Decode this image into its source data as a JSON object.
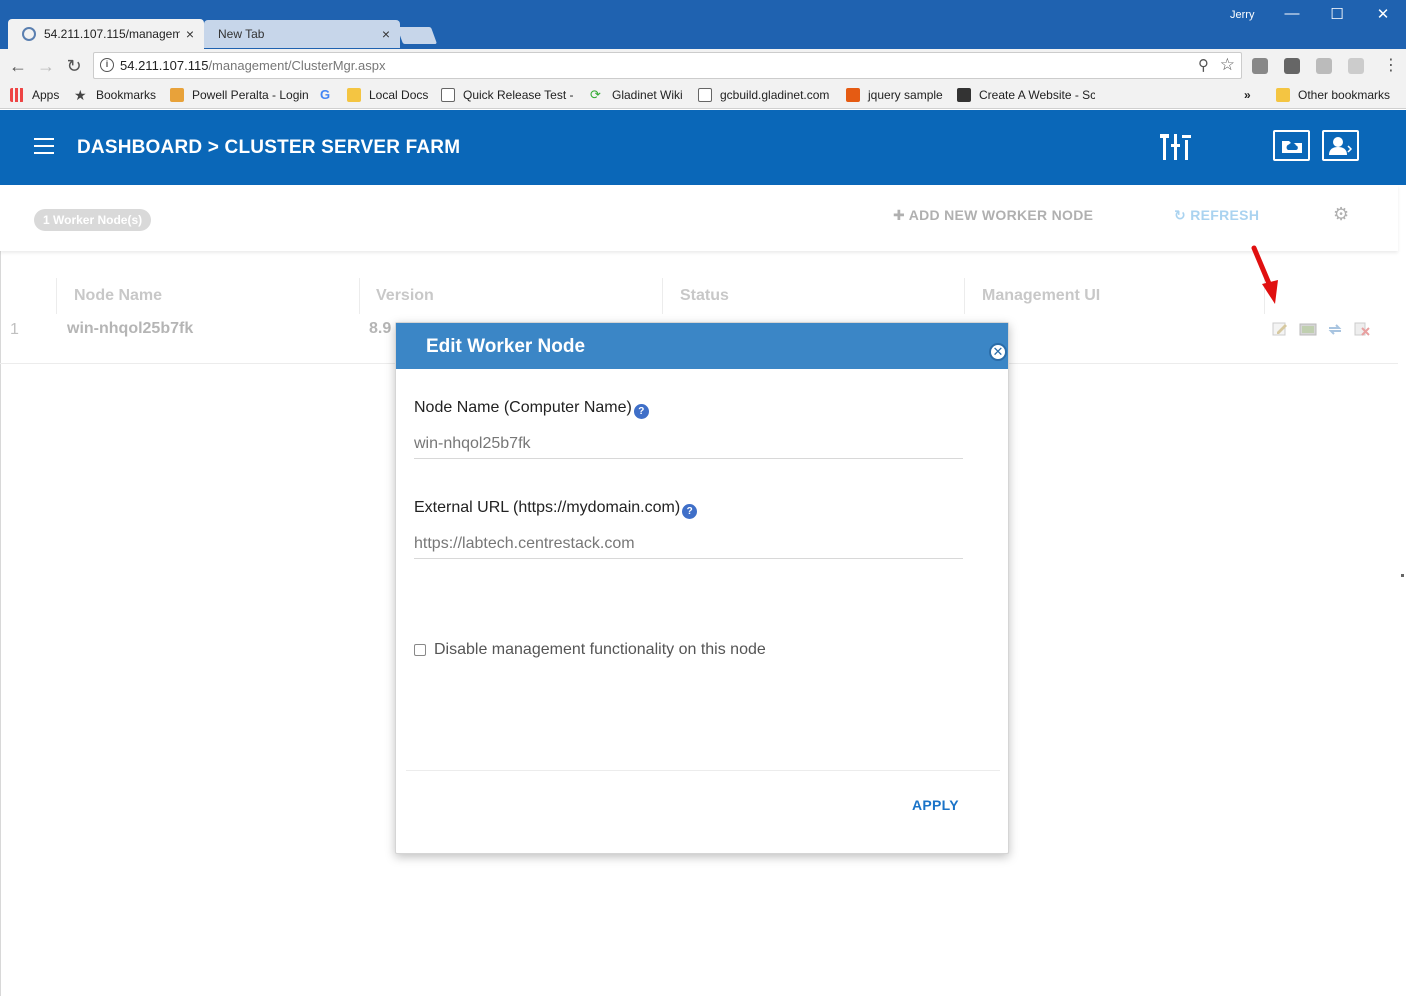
{
  "browser": {
    "tabs": [
      {
        "title": "54.211.107.115/managem",
        "close": "×"
      },
      {
        "title": "New Tab",
        "close": "×"
      }
    ],
    "user": "Jerry",
    "window_controls": {
      "minimize": "—",
      "maximize": "☐",
      "close": "✕"
    },
    "url_host": "54.211.107.115",
    "url_path": "/management/ClusterMgr.aspx",
    "bookmarks": [
      "Apps",
      "Bookmarks",
      "Powell Peralta - Login",
      "",
      "Local Docs",
      "Quick Release Test - (",
      "Gladinet Wiki",
      "gcbuild.gladinet.com",
      "jquery sample",
      "Create A Website - Sc"
    ],
    "bookmarks_overflow": "»",
    "other_bookmarks": "Other bookmarks"
  },
  "header": {
    "breadcrumb": "DASHBOARD >  CLUSTER SERVER FARM"
  },
  "toolbar": {
    "node_count_badge": "1 Worker Node(s)",
    "add_node_label": "ADD NEW WORKER NODE",
    "refresh_label": "REFRESH"
  },
  "table": {
    "columns": [
      "Node Name",
      "Version",
      "Status",
      "Management UI"
    ],
    "rows": [
      {
        "num": "1",
        "node_name": "win-nhqol25b7fk",
        "version": "8.9"
      }
    ]
  },
  "modal": {
    "title": "Edit Worker Node",
    "node_name_label": "Node Name (Computer Name)",
    "node_name_value": "win-nhqol25b7fk",
    "external_url_label": "External URL (https://mydomain.com)",
    "external_url_value": "https://labtech.centrestack.com",
    "disable_mgmt_label": "Disable management functionality on this node",
    "disable_mgmt_checked": false,
    "apply_label": "APPLY"
  },
  "colors": {
    "header_blue": "#0a67b8",
    "modal_head_blue": "#3b86c6",
    "apply_blue": "#1a73c8",
    "annotation_arrow": "#e01010"
  }
}
